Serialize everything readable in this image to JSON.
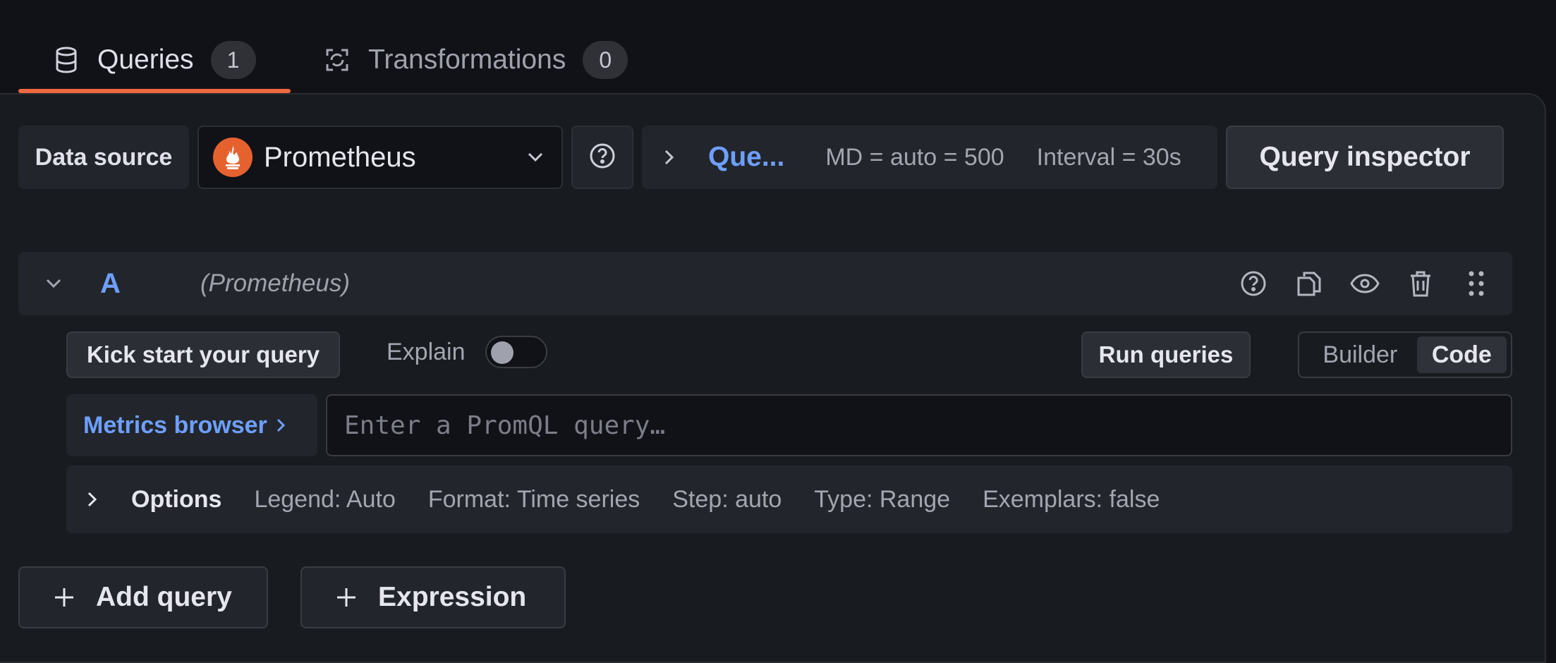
{
  "tabs": [
    {
      "label": "Queries",
      "count": "1",
      "icon": "database-icon",
      "active": true
    },
    {
      "label": "Transformations",
      "count": "0",
      "icon": "transform-icon",
      "active": false
    }
  ],
  "accent_color": "#f0693f",
  "link_color": "#6e9fff",
  "datasource": {
    "label": "Data source",
    "selected": "Prometheus",
    "logo_color": "#e5622f"
  },
  "query_options": {
    "link": "Que...",
    "max_data_points": "MD = auto = 500",
    "interval": "Interval = 30s"
  },
  "query_inspector_label": "Query inspector",
  "query": {
    "ref_id": "A",
    "datasource_name": "(Prometheus)",
    "kick_start_label": "Kick start your query",
    "explain_label": "Explain",
    "explain_enabled": false,
    "run_label": "Run queries",
    "mode_builder": "Builder",
    "mode_code": "Code",
    "mode_selected": "Code",
    "metrics_browser_label": "Metrics browser",
    "promql_placeholder": "Enter a PromQL query…",
    "promql_value": "",
    "options": {
      "title": "Options",
      "legend": "Legend: Auto",
      "format": "Format: Time series",
      "step": "Step: auto",
      "type": "Type: Range",
      "exemplars": "Exemplars: false"
    }
  },
  "add_query_label": "Add query",
  "expression_label": "Expression"
}
